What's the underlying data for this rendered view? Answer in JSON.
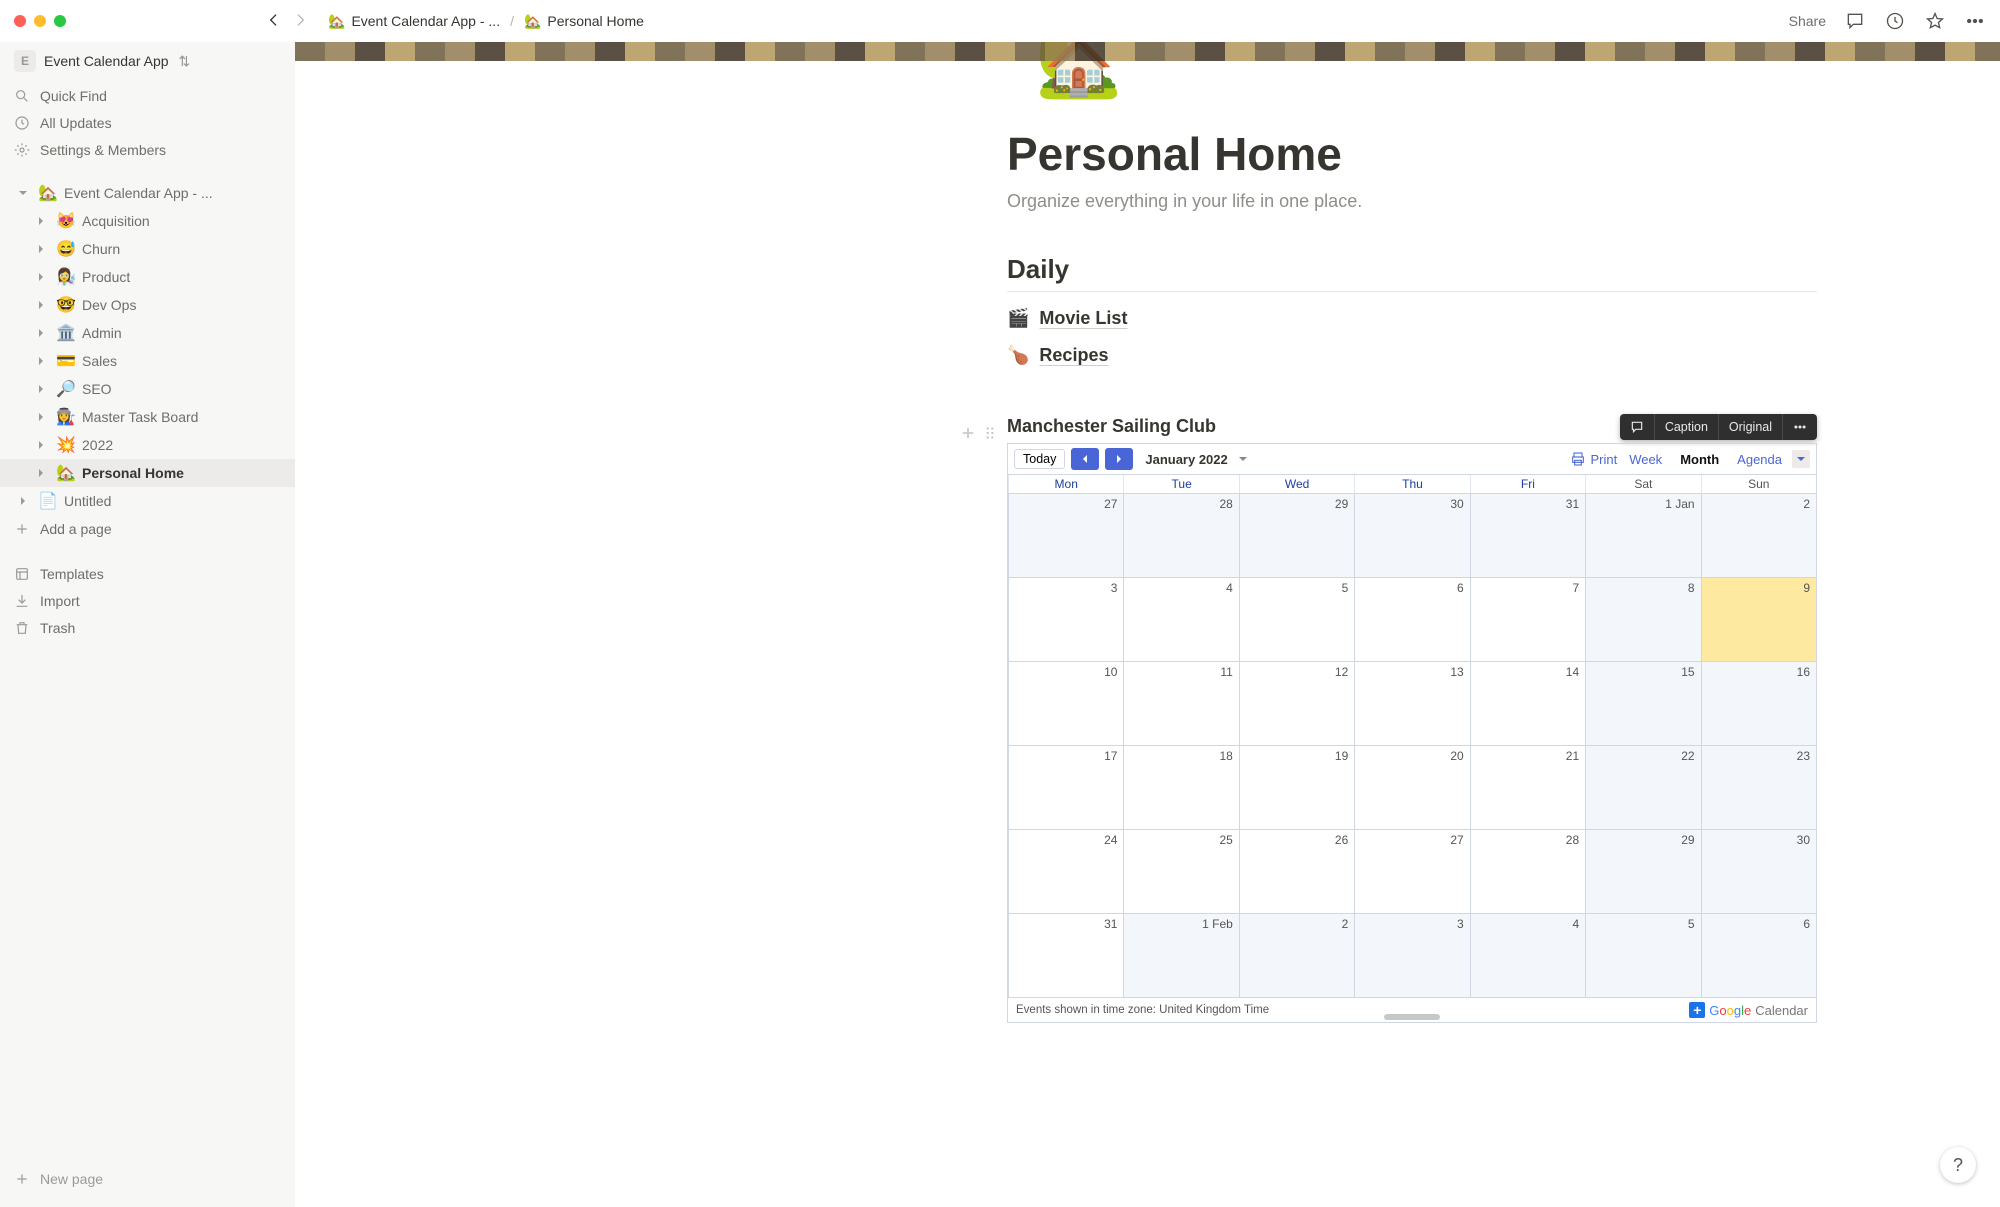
{
  "window": {
    "traffic": true
  },
  "breadcrumbs": {
    "items": [
      {
        "emoji": "🏡",
        "label": "Event Calendar App - ..."
      },
      {
        "emoji": "🏡",
        "label": "Personal Home"
      }
    ],
    "sep": "/"
  },
  "toolbar": {
    "share": "Share"
  },
  "workspace": {
    "initial": "E",
    "name": "Event Calendar App"
  },
  "sidebar": {
    "quick_find": "Quick Find",
    "all_updates": "All Updates",
    "settings": "Settings & Members",
    "tree": [
      {
        "depth": 0,
        "emoji": "🏡",
        "label": "Event Calendar App - ...",
        "open": true
      },
      {
        "depth": 1,
        "emoji": "😻",
        "label": "Acquisition"
      },
      {
        "depth": 1,
        "emoji": "😅",
        "label": "Churn"
      },
      {
        "depth": 1,
        "emoji": "👩‍🔬",
        "label": "Product"
      },
      {
        "depth": 1,
        "emoji": "🤓",
        "label": "Dev Ops"
      },
      {
        "depth": 1,
        "emoji": "🏛️",
        "label": "Admin"
      },
      {
        "depth": 1,
        "emoji": "💳",
        "label": "Sales"
      },
      {
        "depth": 1,
        "emoji": "🔎",
        "label": "SEO"
      },
      {
        "depth": 1,
        "emoji": "👩‍🏭",
        "label": "Master Task Board"
      },
      {
        "depth": 1,
        "emoji": "💥",
        "label": "2022"
      },
      {
        "depth": 1,
        "emoji": "🏡",
        "label": "Personal Home",
        "active": true
      },
      {
        "depth": 0,
        "emoji": "",
        "label": "Untitled",
        "doc": true
      }
    ],
    "add_page": "Add a page",
    "templates": "Templates",
    "import": "Import",
    "trash": "Trash",
    "new_page": "New page"
  },
  "page": {
    "icon": "🏡",
    "title": "Personal Home",
    "subtitle": "Organize everything in your life in one place.",
    "section": "Daily",
    "links": [
      {
        "emoji": "🎬",
        "label": "Movie List"
      },
      {
        "emoji": "🍗",
        "label": "Recipes"
      }
    ]
  },
  "embed_toolbar": {
    "caption": "Caption",
    "original": "Original"
  },
  "calendar": {
    "heading": "Manchester Sailing Club",
    "today_btn": "Today",
    "month_label": "January 2022",
    "print": "Print",
    "tabs": {
      "week": "Week",
      "month": "Month",
      "agenda": "Agenda",
      "active": "Month"
    },
    "weekdays": [
      "Mon",
      "Tue",
      "Wed",
      "Thu",
      "Fri",
      "Sat",
      "Sun"
    ],
    "footer": "Events shown in time zone: United Kingdom Time",
    "google": {
      "brand": "Google",
      "cal": "Calendar"
    },
    "cells": [
      {
        "d": "27",
        "p": true
      },
      {
        "d": "28",
        "p": true
      },
      {
        "d": "29",
        "p": true
      },
      {
        "d": "30",
        "p": true
      },
      {
        "d": "31",
        "p": true
      },
      {
        "d": "1 Jan",
        "w": true
      },
      {
        "d": "2",
        "w": true
      },
      {
        "d": "3"
      },
      {
        "d": "4"
      },
      {
        "d": "5"
      },
      {
        "d": "6"
      },
      {
        "d": "7"
      },
      {
        "d": "8",
        "w": true
      },
      {
        "d": "9",
        "w": true,
        "today": true
      },
      {
        "d": "10"
      },
      {
        "d": "11"
      },
      {
        "d": "12"
      },
      {
        "d": "13"
      },
      {
        "d": "14"
      },
      {
        "d": "15",
        "w": true
      },
      {
        "d": "16",
        "w": true
      },
      {
        "d": "17"
      },
      {
        "d": "18"
      },
      {
        "d": "19"
      },
      {
        "d": "20"
      },
      {
        "d": "21"
      },
      {
        "d": "22",
        "w": true
      },
      {
        "d": "23",
        "w": true
      },
      {
        "d": "24"
      },
      {
        "d": "25"
      },
      {
        "d": "26"
      },
      {
        "d": "27"
      },
      {
        "d": "28"
      },
      {
        "d": "29",
        "w": true
      },
      {
        "d": "30",
        "w": true
      },
      {
        "d": "31"
      },
      {
        "d": "1 Feb",
        "n": true
      },
      {
        "d": "2",
        "n": true
      },
      {
        "d": "3",
        "n": true
      },
      {
        "d": "4",
        "n": true
      },
      {
        "d": "5",
        "n": true,
        "w": true
      },
      {
        "d": "6",
        "n": true,
        "w": true
      }
    ]
  },
  "help": "?"
}
